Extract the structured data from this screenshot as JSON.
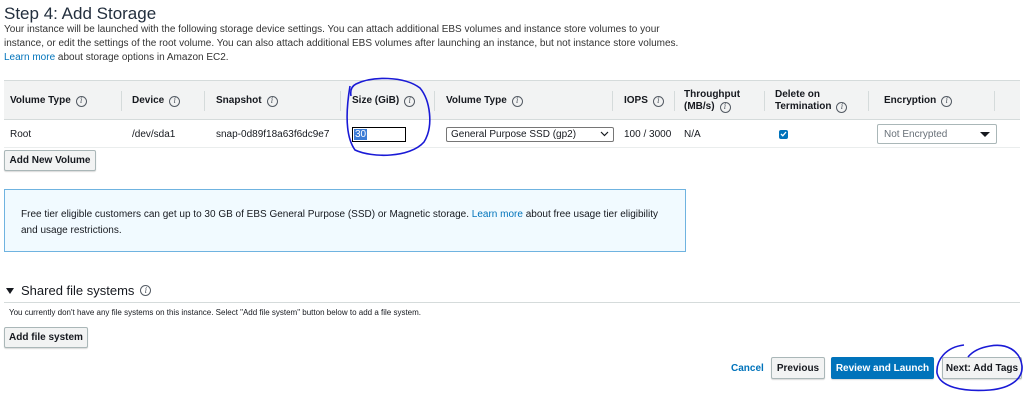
{
  "page": {
    "title": "Step 4: Add Storage",
    "intro_text": "Your instance will be launched with the following storage device settings. You can attach additional EBS volumes and instance store volumes to your instance, or edit the settings of the root volume. You can also attach additional EBS volumes after launching an instance, but not instance store volumes.",
    "intro_link": "Learn more",
    "intro_tail": "about storage options in Amazon EC2."
  },
  "table": {
    "headers": {
      "volume_type": "Volume Type",
      "device": "Device",
      "snapshot": "Snapshot",
      "size": "Size (GiB)",
      "volume_type2": "Volume Type",
      "iops": "IOPS",
      "throughput_1": "Throughput",
      "throughput_2": "(MB/s)",
      "delete_1": "Delete on",
      "delete_2": "Termination",
      "encryption": "Encryption"
    },
    "info_glyph": "i",
    "row": {
      "volume_type": "Root",
      "device": "/dev/sda1",
      "snapshot": "snap-0d89f18a63f6dc9e7",
      "size": "30",
      "ebs_type": "General Purpose SSD (gp2)",
      "iops": "100 / 3000",
      "throughput": "N/A",
      "delete_on_termination": true,
      "encryption": "Not Encrypted"
    }
  },
  "buttons": {
    "add_new_volume": "Add New Volume",
    "add_file_system": "Add file system",
    "cancel": "Cancel",
    "previous": "Previous",
    "review_and_launch": "Review and Launch",
    "next": "Next: Add Tags"
  },
  "free_tier": {
    "text": "Free tier eligible customers can get up to 30 GB of EBS General Purpose (SSD) or Magnetic storage.",
    "link": "Learn more",
    "tail": "about free usage tier eligibility and usage restrictions."
  },
  "shared_fs": {
    "title": "Shared file systems",
    "text": "You currently don't have any file systems on this instance. Select \"Add file system\" button below to add a file system."
  },
  "colors": {
    "primary": "#0073bb",
    "annotation": "#1a1ad6",
    "info_border": "#6fb3e0"
  },
  "icons": {
    "info": "info-icon",
    "dropdown": "chevron-down-icon",
    "collapse": "caret-down-icon",
    "check": "checkmark-icon"
  }
}
